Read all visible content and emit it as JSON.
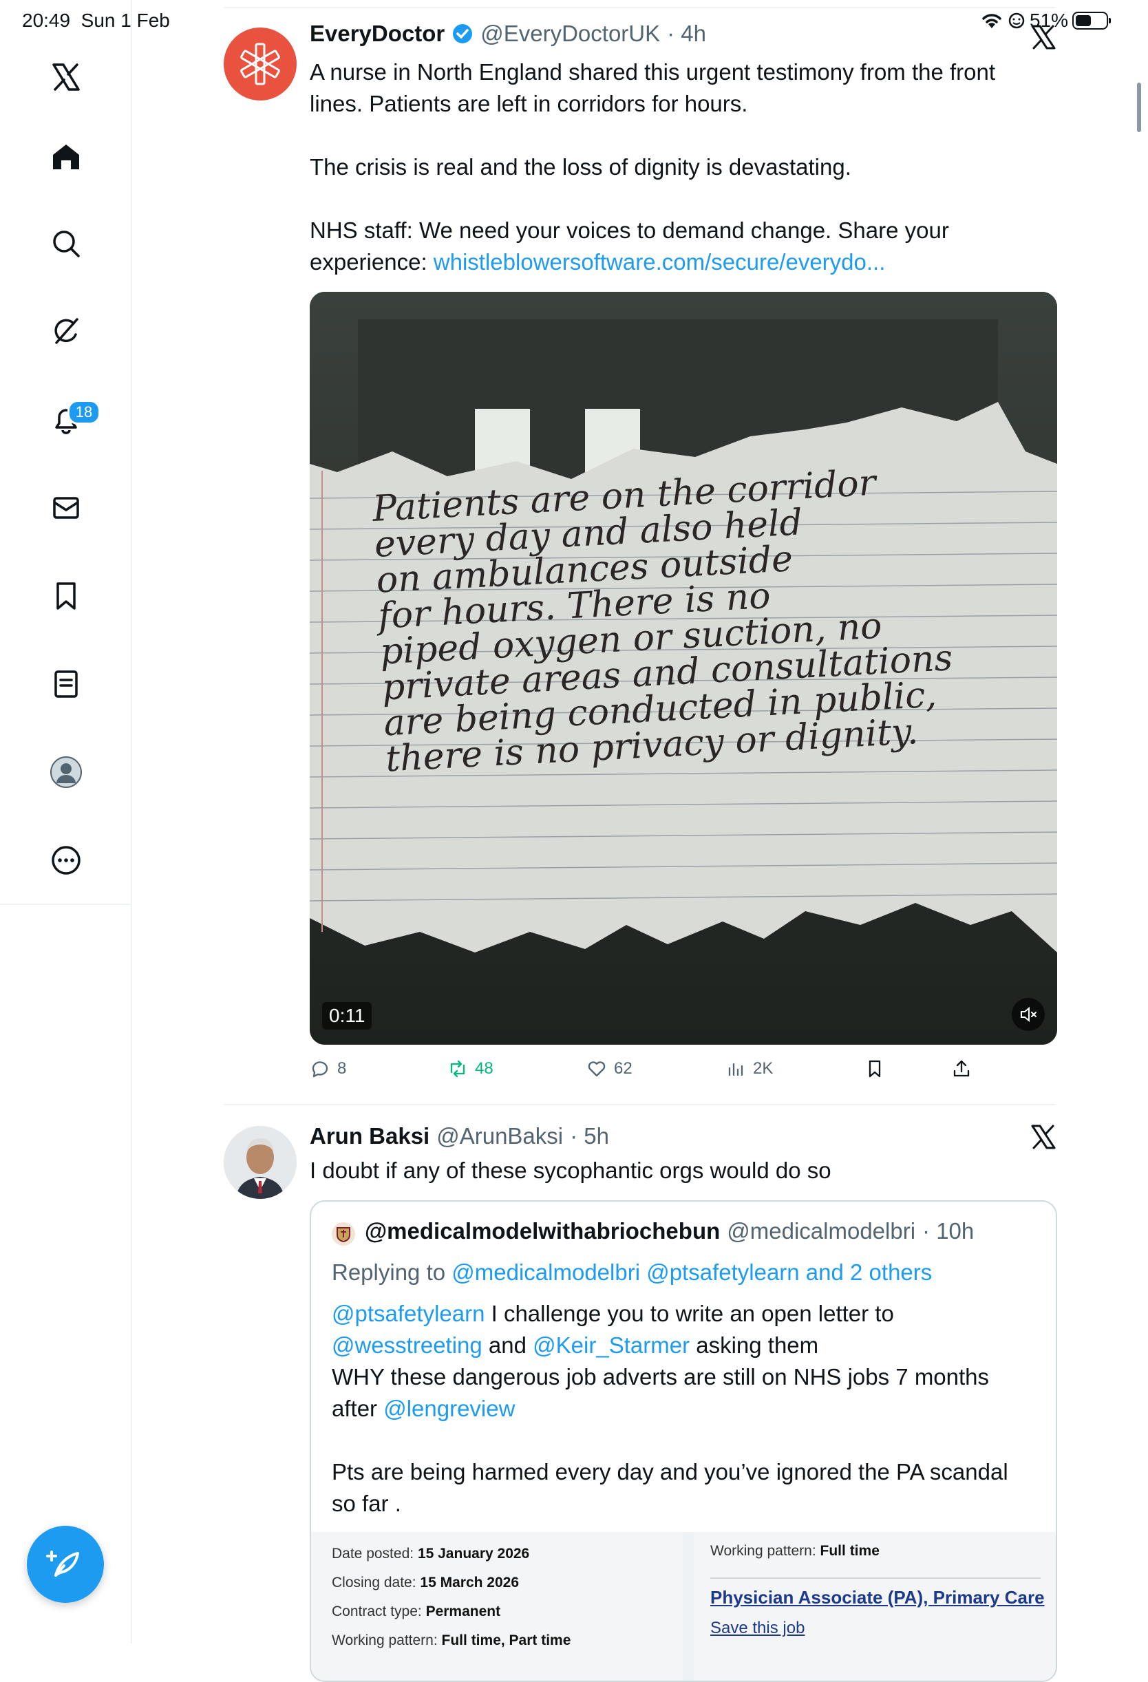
{
  "status_bar": {
    "time": "20:49",
    "date": "Sun 1 Feb",
    "battery": "51%"
  },
  "sidebar": {
    "notifications_badge": "18",
    "items": [
      "x-logo",
      "home",
      "search",
      "grok",
      "notifications",
      "messages",
      "bookmarks",
      "lists",
      "profile",
      "more"
    ]
  },
  "tweet1": {
    "name": "EveryDoctor",
    "handle": "@EveryDoctorUK",
    "time": "· 4h",
    "line1": "A nurse in North England shared this urgent testimony from the front lines. Patients are left in corridors for hours.",
    "line2": "The crisis is real and the loss of dignity is devastating.",
    "line3_prefix": "NHS staff: We need your voices to demand change. Share your experience: ",
    "link": "whistleblowersoftware.com/secure/everydo...",
    "note_lines": [
      "Patients are on the corridor",
      "every day and also held",
      "on   ambulances outside",
      "for hours. There is no",
      "piped oxygen or suction, no",
      "private areas and consultations",
      "are being conducted in public,",
      "there is no privacy or dignity."
    ],
    "video_time": "0:11",
    "replies": "8",
    "reposts": "48",
    "likes": "62",
    "views": "2K"
  },
  "tweet2": {
    "name": "Arun Baksi",
    "handle": "@ArunBaksi",
    "time": "· 5h",
    "text": "I doubt if any of these sycophantic orgs would do so",
    "quote": {
      "name": "@medicalmodelwithabriochebun",
      "handle": "@medicalmodelbri",
      "time": "· 10h",
      "replying_prefix": "Replying to ",
      "replying_to": "@medicalmodelbri @ptsafetylearn and 2 others",
      "mention1": "@ptsafetylearn",
      "text1": " I challenge you to write an open letter to",
      "mention2": "@wesstreeting",
      "and": " and ",
      "mention3": "@Keir_Starmer",
      "text2": " asking them",
      "text3": "WHY these dangerous job adverts are still on NHS jobs 7 months",
      "text4": "after ",
      "mention4": "@lengreview",
      "text5": "Pts are being harmed every day and you’ve ignored the PA scandal",
      "text6": "so far .",
      "snippet": {
        "date_posted_label": "Date posted:",
        "date_posted": "15 January 2026",
        "closing_label": "Closing date:",
        "closing": "15 March 2026",
        "contract_label": "Contract type:",
        "contract": "Permanent",
        "working_label": "Working pattern:",
        "working": "Full time, Part time",
        "working2_label": "Working pattern:",
        "working2": "Full time",
        "job_title": "Physician Associate (PA), Primary Care",
        "save": "Save this job"
      }
    }
  }
}
